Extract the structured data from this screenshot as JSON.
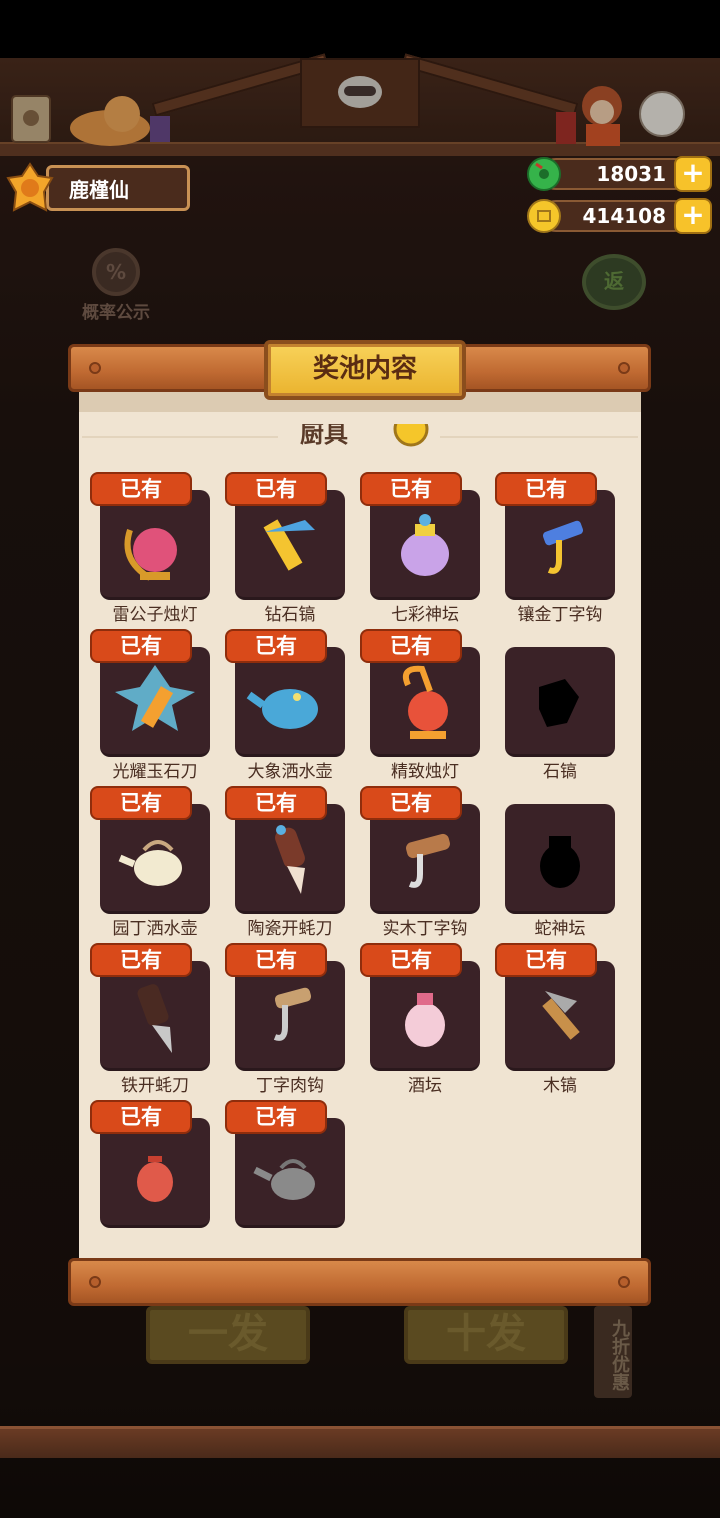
{
  "player": {
    "name": "鹿槿仙"
  },
  "currency": {
    "gems": "18031",
    "coins": "414108",
    "plus": "+"
  },
  "probability": {
    "icon_text": "%",
    "label": "概率公示"
  },
  "back": {
    "label": "返"
  },
  "panel": {
    "title": "奖池内容",
    "section_peek": "厨具",
    "owned_label": "已有",
    "items": [
      {
        "name": "雷公子烛灯",
        "owned": true,
        "icon": "ornate-lamp-icon"
      },
      {
        "name": "钻石镐",
        "owned": true,
        "icon": "diamond-pickaxe-icon"
      },
      {
        "name": "七彩神坛",
        "owned": true,
        "icon": "rainbow-urn-icon"
      },
      {
        "name": "镶金丁字钩",
        "owned": true,
        "icon": "gold-hook-icon"
      },
      {
        "name": "光耀玉石刀",
        "owned": true,
        "icon": "jade-knife-icon"
      },
      {
        "name": "大象洒水壶",
        "owned": true,
        "icon": "elephant-watering-can-icon"
      },
      {
        "name": "精致烛灯",
        "owned": true,
        "icon": "lantern-icon"
      },
      {
        "name": "石镐",
        "owned": false,
        "icon": "stone-pickaxe-silhouette-icon"
      },
      {
        "name": "园丁洒水壶",
        "owned": true,
        "icon": "garden-watering-can-icon"
      },
      {
        "name": "陶瓷开蚝刀",
        "owned": true,
        "icon": "ceramic-oyster-knife-icon"
      },
      {
        "name": "实木丁字钩",
        "owned": true,
        "icon": "wooden-hook-icon"
      },
      {
        "name": "蛇神坛",
        "owned": false,
        "icon": "snake-urn-silhouette-icon"
      },
      {
        "name": "铁开蚝刀",
        "owned": true,
        "icon": "iron-oyster-knife-icon"
      },
      {
        "name": "丁字肉钩",
        "owned": true,
        "icon": "meat-hook-icon"
      },
      {
        "name": "酒坛",
        "owned": true,
        "icon": "wine-jar-icon"
      },
      {
        "name": "木镐",
        "owned": true,
        "icon": "wooden-pickaxe-icon"
      },
      {
        "name": "",
        "owned": true,
        "icon": "red-lantern-icon"
      },
      {
        "name": "",
        "owned": true,
        "icon": "iron-watering-can-icon"
      }
    ]
  },
  "bottom": {
    "single": "一发",
    "ten": "十发",
    "discount": "九折优惠"
  },
  "colors": {
    "owned_badge": "#d94a1a",
    "card_bg": "#3a2227",
    "paper": "#f0e4d2",
    "title_plate": "#f2c342",
    "gem": "#35b34a",
    "coin": "#f5c62a"
  }
}
